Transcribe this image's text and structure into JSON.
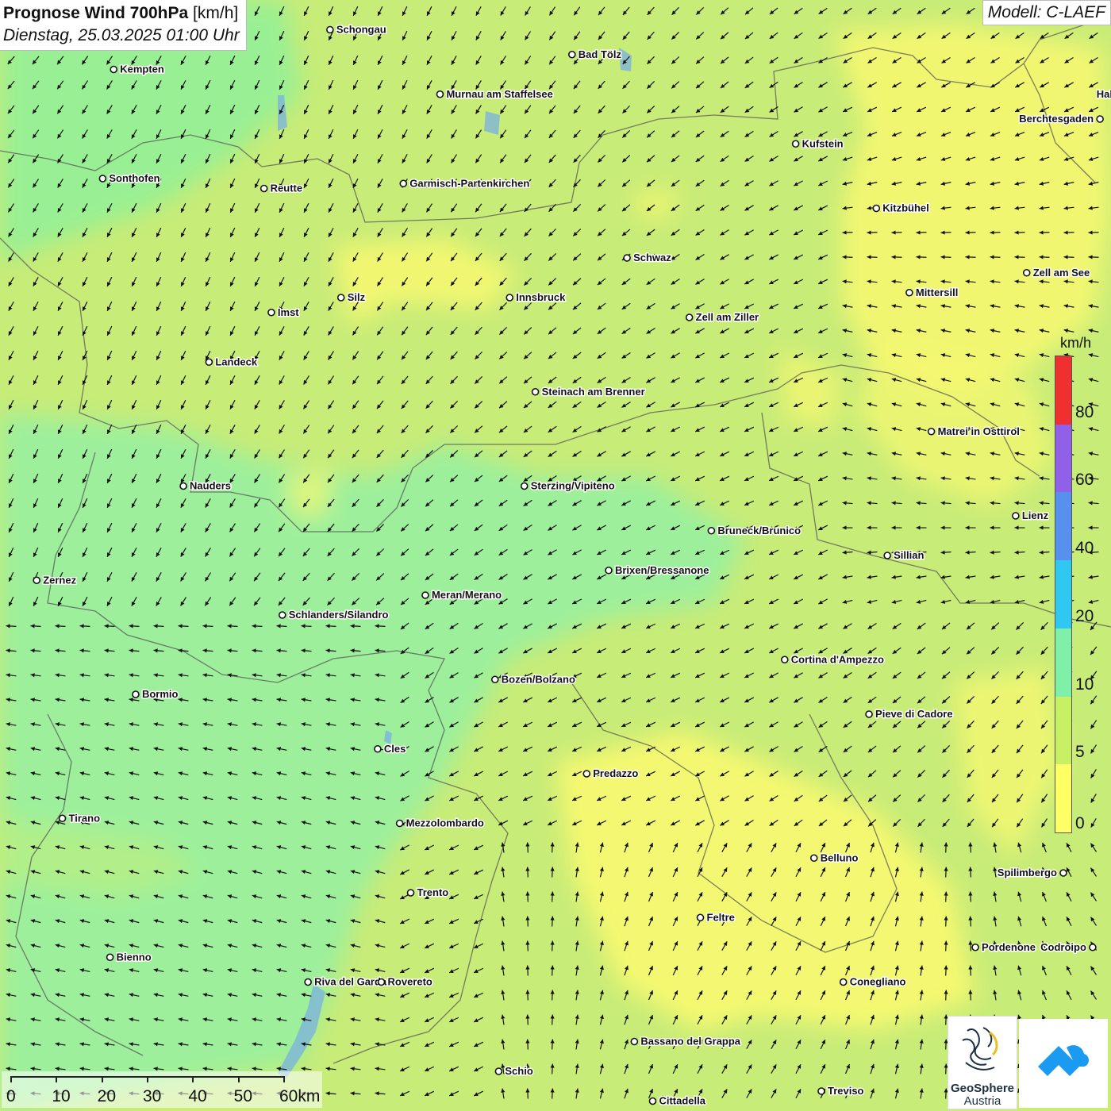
{
  "header": {
    "title_bold": "Prognose Wind 700hPa",
    "title_unit": "[km/h]",
    "subtitle": "Dienstag, 25.03.2025 01:00 Uhr"
  },
  "model": "Modell: C-LAEF",
  "legend": {
    "unit": "km/h",
    "ticks": [
      "0",
      "5",
      "10",
      "20",
      "40",
      "60",
      "80"
    ],
    "colors": [
      "#ffff66",
      "#c8f064",
      "#80f0a8",
      "#30c8f0",
      "#5890f0",
      "#9060e8",
      "#f03030"
    ]
  },
  "scale_bar": {
    "labels": [
      "0",
      "10",
      "20",
      "30",
      "40",
      "50",
      "60km"
    ]
  },
  "logos": {
    "geosphere_line1": "GeoSphere",
    "geosphere_line2": "Austria"
  },
  "cities": [
    {
      "name": "Schongau",
      "lon": 10.9,
      "lat": 47.81
    },
    {
      "name": "Bad Tölz",
      "lon": 11.56,
      "lat": 47.76
    },
    {
      "name": "Kempten",
      "lon": 10.31,
      "lat": 47.73
    },
    {
      "name": "Murnau am Staffelsee",
      "lon": 11.2,
      "lat": 47.68
    },
    {
      "name": "Hallein",
      "lon": 13.1,
      "lat": 47.68
    },
    {
      "name": "Berchtesgaden",
      "lon": 13.0,
      "lat": 47.63
    },
    {
      "name": "Kufstein",
      "lon": 12.17,
      "lat": 47.58
    },
    {
      "name": "Sonthofen",
      "lon": 10.28,
      "lat": 47.51
    },
    {
      "name": "Reutte",
      "lon": 10.72,
      "lat": 47.49
    },
    {
      "name": "Garmisch-Partenkirchen",
      "lon": 11.1,
      "lat": 47.5
    },
    {
      "name": "Kitzbühel",
      "lon": 12.39,
      "lat": 47.45
    },
    {
      "name": "Schwaz",
      "lon": 11.71,
      "lat": 47.35
    },
    {
      "name": "Zell am See",
      "lon": 12.8,
      "lat": 47.32
    },
    {
      "name": "Mittersill",
      "lon": 12.48,
      "lat": 47.28
    },
    {
      "name": "Innsbruck",
      "lon": 11.39,
      "lat": 47.27
    },
    {
      "name": "Silz",
      "lon": 10.93,
      "lat": 47.27
    },
    {
      "name": "Imst",
      "lon": 10.74,
      "lat": 47.24
    },
    {
      "name": "Zell am Ziller",
      "lon": 11.88,
      "lat": 47.23
    },
    {
      "name": "Landeck",
      "lon": 10.57,
      "lat": 47.14
    },
    {
      "name": "Steinach am Brenner",
      "lon": 11.46,
      "lat": 47.08
    },
    {
      "name": "Matrei in Osttirol",
      "lon": 12.54,
      "lat": 47.0
    },
    {
      "name": "Nauders",
      "lon": 10.5,
      "lat": 46.89
    },
    {
      "name": "Sterzing/Vipiteno",
      "lon": 11.43,
      "lat": 46.89
    },
    {
      "name": "Lienz",
      "lon": 12.77,
      "lat": 46.83
    },
    {
      "name": "Bruneck/Brunico",
      "lon": 11.94,
      "lat": 46.8
    },
    {
      "name": "Sillian",
      "lon": 12.42,
      "lat": 46.75
    },
    {
      "name": "Brixen/Bressanone",
      "lon": 11.66,
      "lat": 46.72
    },
    {
      "name": "Zernez",
      "lon": 10.1,
      "lat": 46.7
    },
    {
      "name": "Meran/Merano",
      "lon": 11.16,
      "lat": 46.67
    },
    {
      "name": "Schlanders/Silandro",
      "lon": 10.77,
      "lat": 46.63
    },
    {
      "name": "Cortina d'Ampezzo",
      "lon": 12.14,
      "lat": 46.54
    },
    {
      "name": "Bozen/Bolzano",
      "lon": 11.35,
      "lat": 46.5
    },
    {
      "name": "Bormio",
      "lon": 10.37,
      "lat": 46.47
    },
    {
      "name": "Pieve di Cadore",
      "lon": 12.37,
      "lat": 46.43
    },
    {
      "name": "Cles",
      "lon": 11.03,
      "lat": 46.36
    },
    {
      "name": "Predazzo",
      "lon": 11.6,
      "lat": 46.31
    },
    {
      "name": "Tirano",
      "lon": 10.17,
      "lat": 46.22
    },
    {
      "name": "Mezzolombardo",
      "lon": 11.09,
      "lat": 46.21
    },
    {
      "name": "Belluno",
      "lon": 12.22,
      "lat": 46.14
    },
    {
      "name": "Spilimbergo",
      "lon": 12.9,
      "lat": 46.11
    },
    {
      "name": "Trento",
      "lon": 11.12,
      "lat": 46.07
    },
    {
      "name": "Feltre",
      "lon": 11.91,
      "lat": 46.02
    },
    {
      "name": "Pordenone",
      "lon": 12.66,
      "lat": 45.96
    },
    {
      "name": "Codroipo",
      "lon": 12.98,
      "lat": 45.96
    },
    {
      "name": "Bienno",
      "lon": 10.3,
      "lat": 45.94
    },
    {
      "name": "Conegliano",
      "lon": 12.3,
      "lat": 45.89
    },
    {
      "name": "Riva del Garda",
      "lon": 10.84,
      "lat": 45.89
    },
    {
      "name": "Rovereto",
      "lon": 11.04,
      "lat": 45.89
    },
    {
      "name": "Bassano del Grappa",
      "lon": 11.73,
      "lat": 45.77
    },
    {
      "name": "Schio",
      "lon": 11.36,
      "lat": 45.71
    },
    {
      "name": "Treviso",
      "lon": 12.24,
      "lat": 45.67
    },
    {
      "name": "Cittadella",
      "lon": 11.78,
      "lat": 45.65
    }
  ],
  "map_extent": {
    "lon_min": 10.0,
    "lon_max": 13.03,
    "lat_min": 45.63,
    "lat_max": 47.87
  }
}
